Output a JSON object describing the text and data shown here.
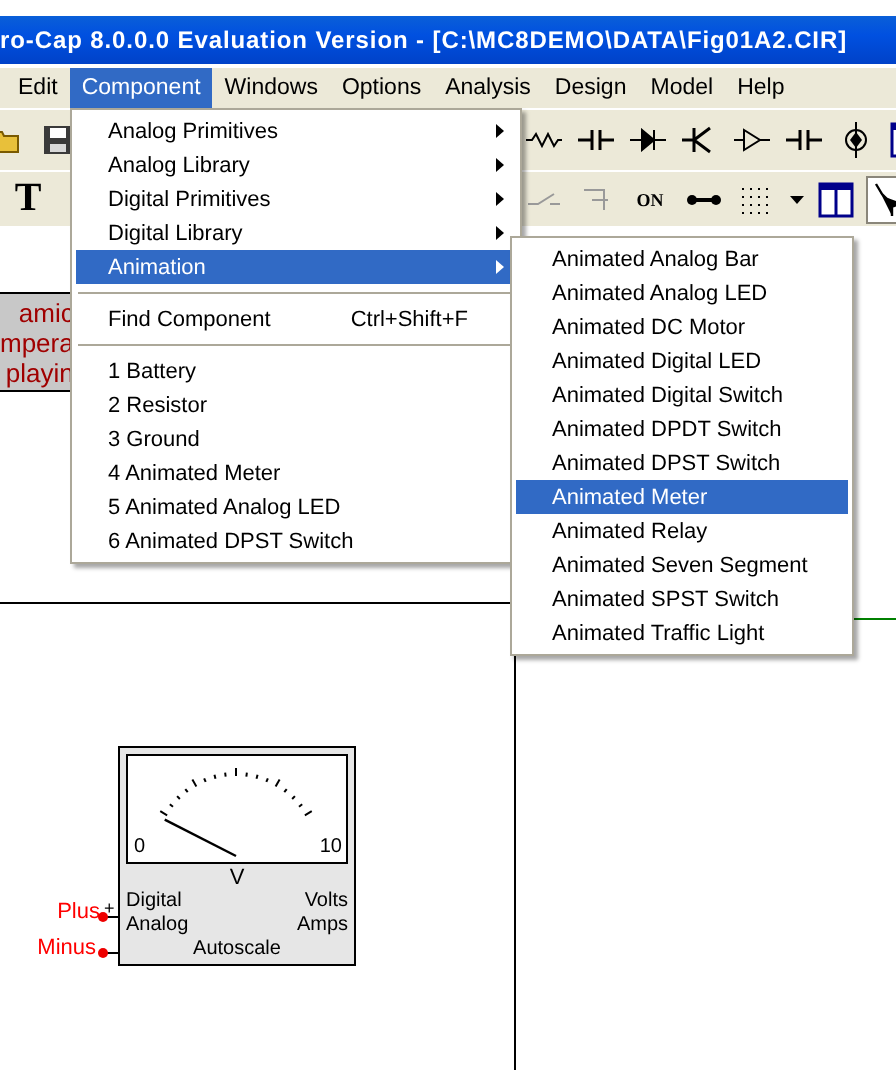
{
  "window": {
    "title": "ro-Cap 8.0.0.0 Evaluation Version - [C:\\MC8DEMO\\DATA\\Fig01A2.CIR]"
  },
  "menubar": [
    {
      "label": "Edit",
      "selected": false
    },
    {
      "label": "Component",
      "selected": true
    },
    {
      "label": "Windows",
      "selected": false
    },
    {
      "label": "Options",
      "selected": false
    },
    {
      "label": "Analysis",
      "selected": false
    },
    {
      "label": "Design",
      "selected": false
    },
    {
      "label": "Model",
      "selected": false
    },
    {
      "label": "Help",
      "selected": false
    }
  ],
  "toolbar_1": {
    "left": [
      {
        "kind": "folder",
        "selected": false
      },
      {
        "kind": "save",
        "selected": false
      }
    ],
    "right": [
      {
        "kind": "resistor",
        "selected": false
      },
      {
        "kind": "capacitor",
        "selected": false
      },
      {
        "kind": "diode",
        "selected": false
      },
      {
        "kind": "transistor",
        "selected": false
      },
      {
        "kind": "buffer",
        "selected": false
      },
      {
        "kind": "capacitor",
        "selected": false
      },
      {
        "kind": "source",
        "selected": false
      },
      {
        "kind": "window",
        "selected": false
      }
    ]
  },
  "toolbar_2": {
    "left": [
      {
        "kind": "text",
        "label": "T",
        "selected": false
      }
    ],
    "right": [
      {
        "kind": "switch",
        "selected": false
      },
      {
        "kind": "relay",
        "selected": false
      },
      {
        "kind": "text",
        "label": "ON",
        "selected": false
      },
      {
        "kind": "wire",
        "selected": false
      },
      {
        "kind": "grid",
        "selected": false
      },
      {
        "kind": "caret",
        "selected": false
      },
      {
        "kind": "window",
        "selected": false
      },
      {
        "kind": "pointer",
        "selected": true
      }
    ]
  },
  "component_menu": [
    [
      {
        "label": "Analog Primitives",
        "submenu": true,
        "selected": false
      },
      {
        "label": "Analog Library",
        "submenu": true,
        "selected": false
      },
      {
        "label": "Digital Primitives",
        "submenu": true,
        "selected": false
      },
      {
        "label": "Digital Library",
        "submenu": true,
        "selected": false
      },
      {
        "label": "Animation",
        "submenu": true,
        "selected": true
      }
    ],
    [
      {
        "label": "Find Component",
        "shortcut": "Ctrl+Shift+F",
        "submenu": false,
        "selected": false
      }
    ],
    [
      {
        "label": "1 Battery",
        "submenu": false,
        "selected": false
      },
      {
        "label": "2 Resistor",
        "submenu": false,
        "selected": false
      },
      {
        "label": "3 Ground",
        "submenu": false,
        "selected": false
      },
      {
        "label": "4 Animated Meter",
        "submenu": false,
        "selected": false
      },
      {
        "label": "5 Animated Analog LED",
        "submenu": false,
        "selected": false
      },
      {
        "label": "6 Animated DPST Switch",
        "submenu": false,
        "selected": false
      }
    ]
  ],
  "animation_submenu": [
    {
      "label": "Animated Analog Bar",
      "selected": false
    },
    {
      "label": "Animated Analog LED",
      "selected": false
    },
    {
      "label": "Animated DC Motor",
      "selected": false
    },
    {
      "label": "Animated Digital LED",
      "selected": false
    },
    {
      "label": "Animated Digital Switch",
      "selected": false
    },
    {
      "label": "Animated DPDT Switch",
      "selected": false
    },
    {
      "label": "Animated DPST Switch",
      "selected": false
    },
    {
      "label": "Animated Meter",
      "selected": true
    },
    {
      "label": "Animated Relay",
      "selected": false
    },
    {
      "label": "Animated Seven Segment",
      "selected": false
    },
    {
      "label": "Animated SPST Switch",
      "selected": false
    },
    {
      "label": "Animated Traffic Light",
      "selected": false
    }
  ],
  "canvas": {
    "text_box": [
      "amic",
      "mpera",
      "playin"
    ],
    "meter": {
      "scale_min": "0",
      "scale_max": "10",
      "unit": "V",
      "mode_labels": [
        "Digital",
        "Analog"
      ],
      "unit_labels": [
        "Volts",
        "Amps"
      ],
      "footer": "Autoscale",
      "plus_mark": "+"
    },
    "pins": [
      "Plus",
      "Minus"
    ]
  }
}
